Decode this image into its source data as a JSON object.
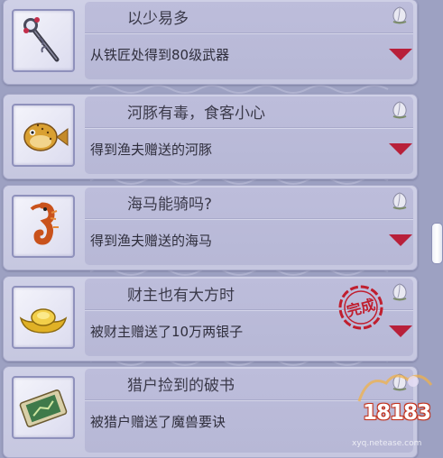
{
  "achievements": [
    {
      "title": "以少易多",
      "desc": "从铁匠处得到80级武器",
      "icon": "magic-staff-icon",
      "completed": false
    },
    {
      "title": "河豚有毒，食客小心",
      "desc": "得到渔夫赠送的河豚",
      "icon": "pufferfish-icon",
      "completed": false
    },
    {
      "title": "海马能骑吗?",
      "desc": "得到渔夫赠送的海马",
      "icon": "seahorse-icon",
      "completed": false
    },
    {
      "title": "财主也有大方时",
      "desc": "被财主赠送了10万两银子",
      "icon": "gold-ingot-icon",
      "completed": true
    },
    {
      "title": "猎户捡到的破书",
      "desc": "被猎户赠送了魔兽要诀",
      "icon": "scroll-book-icon",
      "completed": false
    }
  ],
  "stamp_text": "完成",
  "watermark": {
    "logo": "18183",
    "url": "xyq.netease.com"
  },
  "colors": {
    "panel": "#c6c7e0",
    "text": "#2f2e3c",
    "chevron": "#b8203a",
    "stamp": "#c01e2e"
  }
}
